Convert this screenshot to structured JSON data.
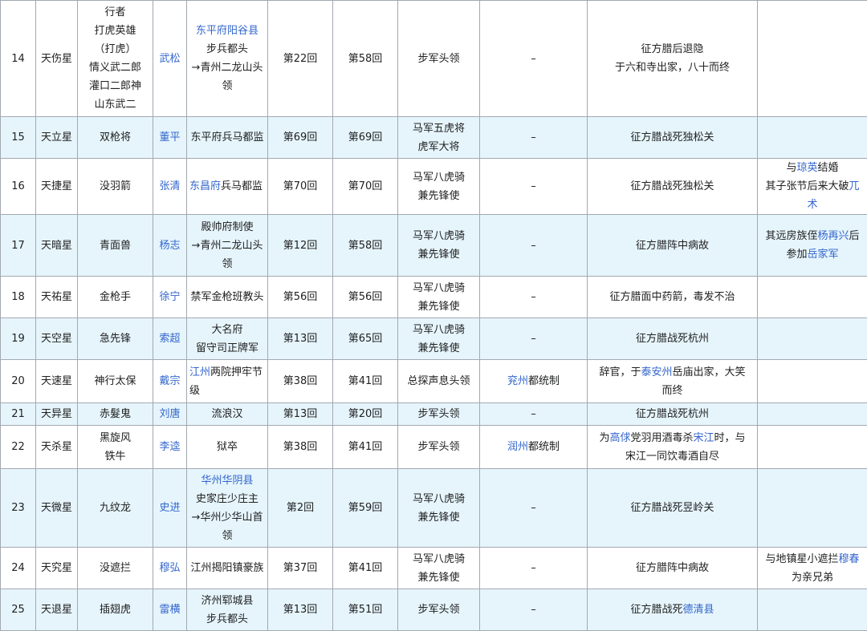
{
  "rows": [
    {
      "no": "14",
      "star": "天伤星",
      "nick": "行者\n打虎英雄\n（打虎）\n情义武二郎\n灌口二郎神\n山东武二",
      "name": "武松",
      "origin": [
        {
          "t": "东平府阳谷县",
          "l": true
        },
        {
          "t": "\n步兵都头\n→青州二龙山头领",
          "l": false
        }
      ],
      "first": "第22回",
      "join": "第58回",
      "post": "步军头领",
      "later": "–",
      "fate": [
        {
          "t": "征方腊后退隐\n于六和寺出家，八十而终",
          "l": false
        }
      ],
      "note": []
    },
    {
      "no": "15",
      "star": "天立星",
      "nick": "双枪将",
      "name": "董平",
      "origin": [
        {
          "t": "东平府兵马都监",
          "l": false
        }
      ],
      "first": "第69回",
      "join": "第69回",
      "post": "马军五虎将\n虎军大将",
      "later": "–",
      "fate": [
        {
          "t": "征方腊战死独松关",
          "l": false
        }
      ],
      "note": []
    },
    {
      "no": "16",
      "star": "天捷星",
      "nick": "没羽箭",
      "name": "张清",
      "origin": [
        {
          "t": "东昌府",
          "l": true
        },
        {
          "t": "兵马都监",
          "l": false
        }
      ],
      "first": "第70回",
      "join": "第70回",
      "post": "马军八虎骑\n兼先锋使",
      "later": "–",
      "fate": [
        {
          "t": "征方腊战死独松关",
          "l": false
        }
      ],
      "note": [
        {
          "t": "与",
          "l": false
        },
        {
          "t": "琼英",
          "l": true
        },
        {
          "t": "结婚\n其子张节后来大破",
          "l": false
        },
        {
          "t": "兀术",
          "l": true
        }
      ]
    },
    {
      "no": "17",
      "star": "天暗星",
      "nick": "青面兽",
      "name": "杨志",
      "origin": [
        {
          "t": "殿帅府制使\n→青州二龙山头领",
          "l": false
        }
      ],
      "first": "第12回",
      "join": "第58回",
      "post": "马军八虎骑\n兼先锋使",
      "later": "–",
      "fate": [
        {
          "t": "征方腊阵中病故",
          "l": false
        }
      ],
      "note": [
        {
          "t": "其远房族侄",
          "l": false
        },
        {
          "t": "杨再兴",
          "l": true
        },
        {
          "t": "后参加",
          "l": false
        },
        {
          "t": "岳家军",
          "l": true
        }
      ]
    },
    {
      "no": "18",
      "star": "天祐星",
      "nick": "金枪手",
      "name": "徐宁",
      "origin": [
        {
          "t": "禁军金枪班教头",
          "l": false
        }
      ],
      "first": "第56回",
      "join": "第56回",
      "post": "马军八虎骑\n兼先锋使",
      "later": "–",
      "fate": [
        {
          "t": "征方腊面中药箭，毒发不治",
          "l": false
        }
      ],
      "note": []
    },
    {
      "no": "19",
      "star": "天空星",
      "nick": "急先锋",
      "name": "索超",
      "origin": [
        {
          "t": "大名府\n留守司正牌军",
          "l": false
        }
      ],
      "first": "第13回",
      "join": "第65回",
      "post": "马军八虎骑\n兼先锋使",
      "later": "–",
      "fate": [
        {
          "t": "征方腊战死杭州",
          "l": false
        }
      ],
      "note": []
    },
    {
      "no": "20",
      "star": "天速星",
      "nick": "神行太保",
      "name": "戴宗",
      "origin": [
        {
          "t": "江州",
          "l": true
        },
        {
          "t": "两院押牢节级",
          "l": false
        }
      ],
      "first": "第38回",
      "join": "第41回",
      "post": "总探声息头领",
      "laterParts": [
        {
          "t": "兖州",
          "l": true
        },
        {
          "t": "都统制",
          "l": false
        }
      ],
      "fate": [
        {
          "t": "辞官，于",
          "l": false
        },
        {
          "t": "泰安州",
          "l": true
        },
        {
          "t": "岳庙出家，大笑而终",
          "l": false
        }
      ],
      "note": []
    },
    {
      "no": "21",
      "star": "天异星",
      "nick": "赤髮鬼",
      "name": "刘唐",
      "origin": [
        {
          "t": "流浪汉",
          "l": false
        }
      ],
      "first": "第13回",
      "join": "第20回",
      "post": "步军头领",
      "later": "–",
      "fate": [
        {
          "t": "征方腊战死杭州",
          "l": false
        }
      ],
      "note": []
    },
    {
      "no": "22",
      "star": "天杀星",
      "nick": "黑旋风\n铁牛",
      "name": "李逵",
      "origin": [
        {
          "t": "狱卒",
          "l": false
        }
      ],
      "first": "第38回",
      "join": "第41回",
      "post": "步军头领",
      "laterParts": [
        {
          "t": "润州",
          "l": true
        },
        {
          "t": "都统制",
          "l": false
        }
      ],
      "fate": [
        {
          "t": "为",
          "l": false
        },
        {
          "t": "高俅",
          "l": true
        },
        {
          "t": "党羽用酒毒杀",
          "l": false
        },
        {
          "t": "宋江",
          "l": true
        },
        {
          "t": "时，与宋江一同饮毒酒自尽",
          "l": false
        }
      ],
      "note": []
    },
    {
      "no": "23",
      "star": "天微星",
      "nick": "九纹龙",
      "name": "史进",
      "origin": [
        {
          "t": "华州华阴县",
          "l": true
        },
        {
          "t": "\n史家庄少庄主\n→华州少华山首领",
          "l": false
        }
      ],
      "first": "第2回",
      "join": "第59回",
      "post": "马军八虎骑\n兼先锋使",
      "later": "–",
      "fate": [
        {
          "t": "征方腊战死昱岭关",
          "l": false
        }
      ],
      "note": []
    },
    {
      "no": "24",
      "star": "天究星",
      "nick": "没遮拦",
      "name": "穆弘",
      "origin": [
        {
          "t": "江州揭阳镇豪族",
          "l": false
        }
      ],
      "first": "第37回",
      "join": "第41回",
      "post": "马军八虎骑\n兼先锋使",
      "later": "–",
      "fate": [
        {
          "t": "征方腊阵中病故",
          "l": false
        }
      ],
      "note": [
        {
          "t": "与地镇星小遮拦",
          "l": false
        },
        {
          "t": "穆春",
          "l": true
        },
        {
          "t": "为亲兄弟",
          "l": false
        }
      ]
    },
    {
      "no": "25",
      "star": "天退星",
      "nick": "插翅虎",
      "name": "雷横",
      "origin": [
        {
          "t": "济州郓城县\n步兵都头",
          "l": false
        }
      ],
      "first": "第13回",
      "join": "第51回",
      "post": "步军头领",
      "later": "–",
      "fate": [
        {
          "t": "征方腊战死",
          "l": false
        },
        {
          "t": "德清县",
          "l": true
        }
      ],
      "note": []
    }
  ]
}
